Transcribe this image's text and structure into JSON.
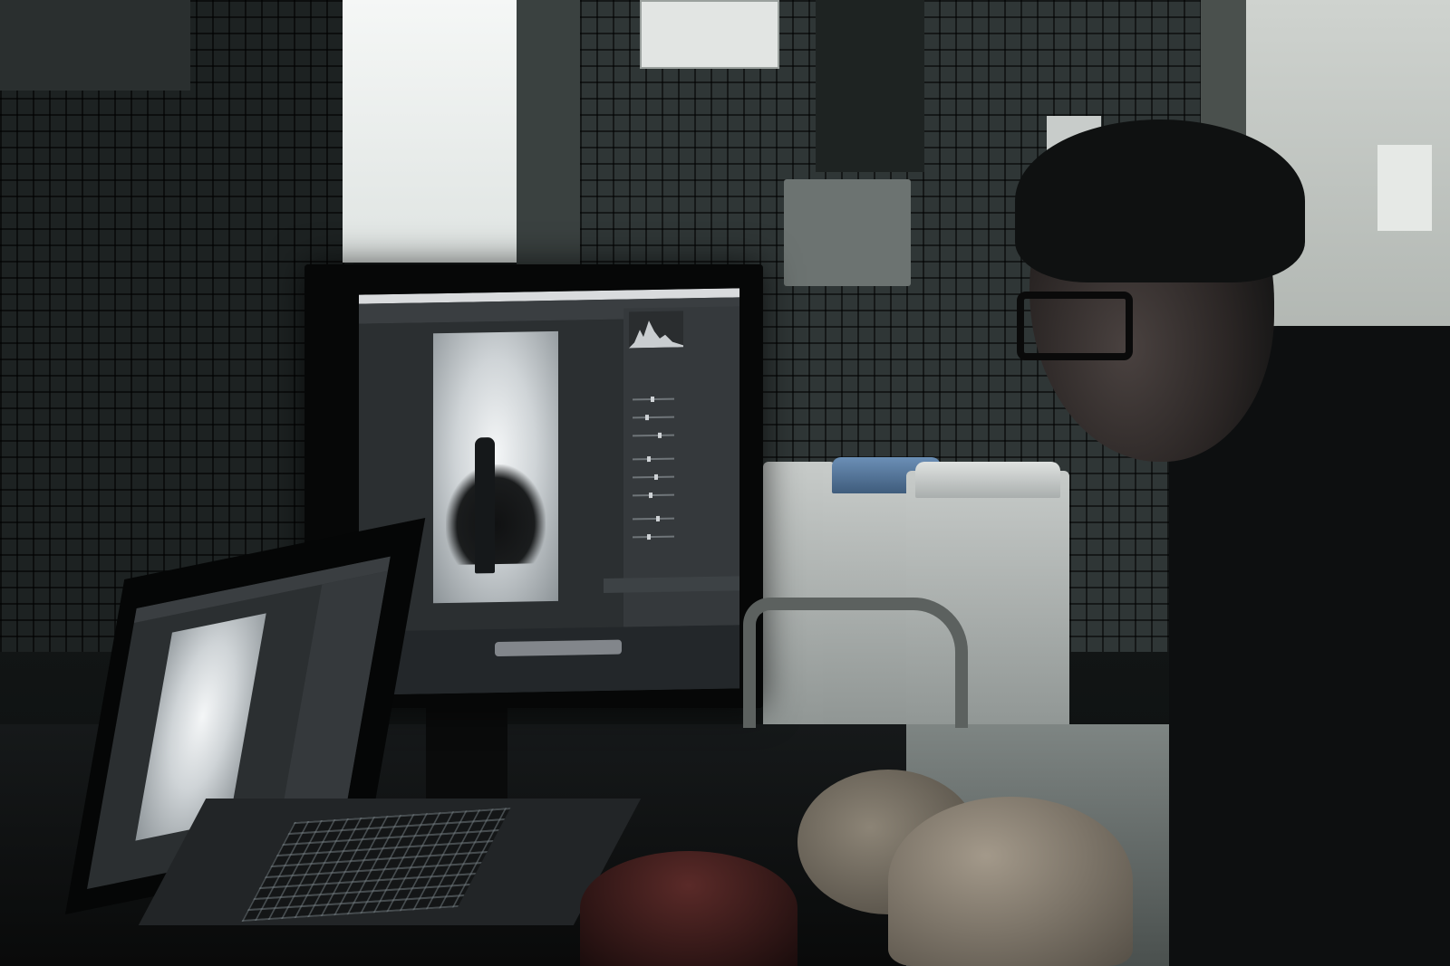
{
  "scene": {
    "description_colors": {
      "wall": "#2f3636",
      "screen_glow": "#e9eef0",
      "panel": "#35393c"
    }
  }
}
